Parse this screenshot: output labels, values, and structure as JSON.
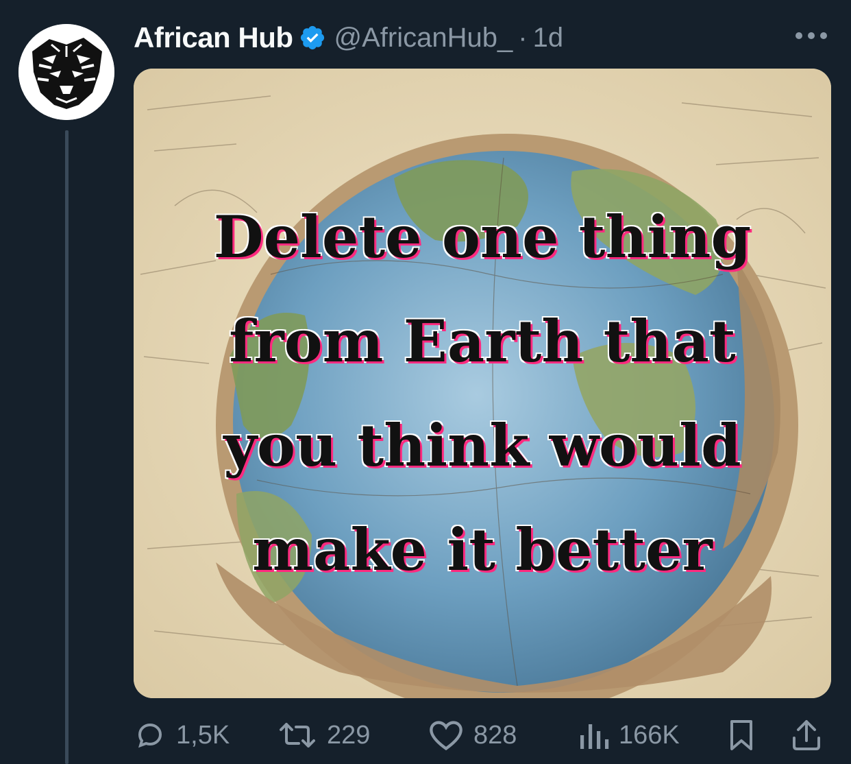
{
  "tweet": {
    "display_name": "African Hub",
    "handle": "@AfricanHub_",
    "separator": "·",
    "time": "1d",
    "verified": true,
    "avatar_icon": "tiger-avatar-icon",
    "media": {
      "lines": [
        "Delete one thing",
        "from Earth that",
        "you think would",
        "make it better"
      ]
    },
    "actions": {
      "replies": "1,5K",
      "retweets": "229",
      "likes": "828",
      "views": "166K"
    }
  },
  "colors": {
    "background": "#15202b",
    "text_primary": "#f7f9f9",
    "text_secondary": "#8b98a5",
    "verified_blue": "#1d9bf0"
  }
}
